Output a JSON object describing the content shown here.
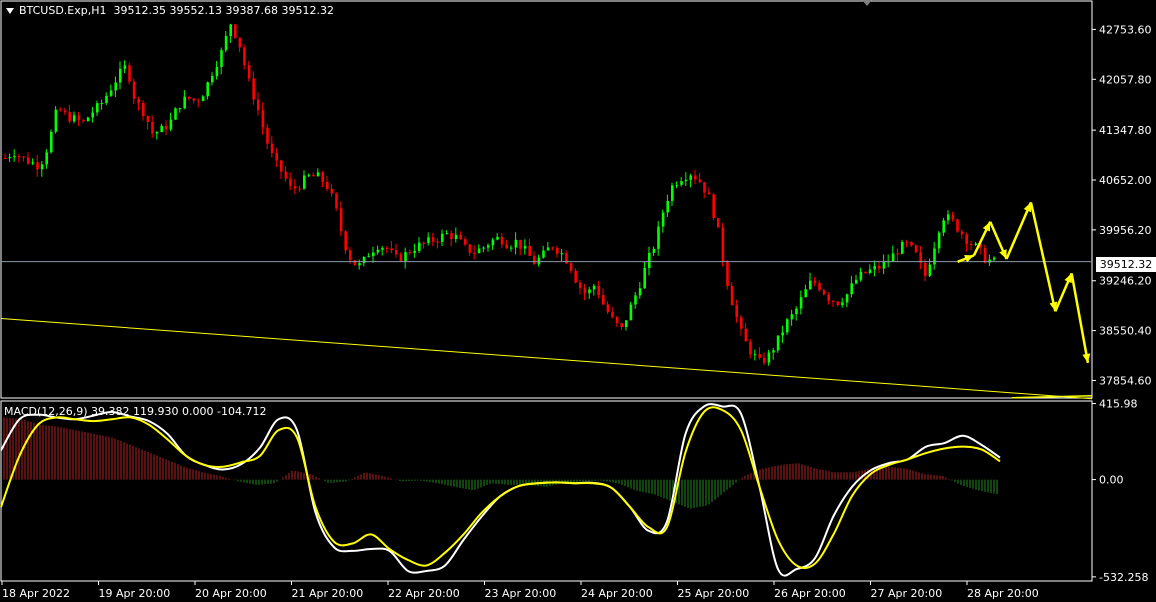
{
  "header": {
    "symbol": "BTCUSD.Exp,H1",
    "ohlc": "39512.35 39552.13 39387.68 39512.32"
  },
  "macd_header": "MACD(12,26,9) 39.382 119.930 0.000 -104.712",
  "current_price_tag": "39512.32",
  "colors": {
    "background": "#000000",
    "bull_candle": "#00ff00",
    "bear_candle": "#ff0000",
    "grid_frame": "#ffffff",
    "trendline": "#ffff00",
    "macd_line": "#ffffff",
    "signal_line": "#ffff00",
    "hist_positive": "#b22222",
    "hist_negative": "#228b22",
    "current_price_line": "#8a9aa8"
  },
  "chart_data": [
    {
      "type": "candlestick",
      "title": "BTCUSD.Exp,H1",
      "price_axis_ticks": [
        "42753.60",
        "42057.80",
        "41347.80",
        "40652.00",
        "39956.20",
        "39246.20",
        "38550.40",
        "37854.60"
      ],
      "time_axis_ticks": [
        "18 Apr 2022",
        "19 Apr 20:00",
        "20 Apr 20:00",
        "21 Apr 20:00",
        "22 Apr 20:00",
        "23 Apr 20:00",
        "24 Apr 20:00",
        "25 Apr 20:00",
        "26 Apr 20:00",
        "27 Apr 20:00",
        "28 Apr 20:00"
      ],
      "ylim": [
        37610,
        43150
      ],
      "current_price": 39512.32,
      "close_path": [
        40960,
        41050,
        40950,
        40900,
        40850,
        41150,
        41650,
        41550,
        41500,
        41450,
        41600,
        41700,
        41900,
        42100,
        42250,
        41750,
        41600,
        41300,
        41350,
        41450,
        41700,
        41800,
        41750,
        41900,
        42200,
        42450,
        42850,
        42550,
        42050,
        41700,
        41250,
        40900,
        40750,
        40500,
        40600,
        40700,
        40700,
        40600,
        40300,
        39800,
        39500,
        39450,
        39650,
        39750,
        39700,
        39550,
        39600,
        39700,
        39750,
        39800,
        39850,
        39900,
        39850,
        39700,
        39650,
        39700,
        39800,
        39850,
        39750,
        39800,
        39650,
        39500,
        39600,
        39750,
        39650,
        39500,
        39200,
        39050,
        39200,
        38900,
        38700,
        38550,
        38850,
        39150,
        39500,
        39800,
        40300,
        40600,
        40700,
        40750,
        40650,
        40450,
        40050,
        39350,
        38850,
        38450,
        38250,
        38100,
        38200,
        38400,
        38650,
        38800,
        39050,
        39250,
        39150,
        39000,
        38950,
        39050,
        39250,
        39350,
        39400,
        39450,
        39550,
        39700,
        39750,
        39600,
        39300,
        39700,
        40150,
        40100,
        39950,
        39800,
        39700,
        39550,
        39510
      ],
      "forecast_arrows": [
        {
          "from_time": 117.5,
          "from_price": 39510,
          "to_time": 119.5,
          "to_price": 39600
        },
        {
          "from_time": 119.5,
          "from_price": 39600,
          "to_time": 121.5,
          "to_price": 40070
        },
        {
          "from_time": 121.5,
          "from_price": 40070,
          "to_time": 123.5,
          "to_price": 39550
        },
        {
          "from_time": 123.5,
          "from_price": 39550,
          "to_time": 126.5,
          "to_price": 40340
        },
        {
          "from_time": 126.5,
          "from_price": 40340,
          "to_time": 129.5,
          "to_price": 38820
        },
        {
          "from_time": 129.5,
          "from_price": 38820,
          "to_time": 131.5,
          "to_price": 39350
        },
        {
          "from_time": 131.5,
          "from_price": 39350,
          "to_time": 133.5,
          "to_price": 38100
        }
      ],
      "trendline": [
        {
          "time": 0,
          "price": 38720
        },
        {
          "time": 134,
          "price": 37600
        }
      ]
    },
    {
      "type": "line",
      "title": "MACD(12,26,9)",
      "axis_ticks": [
        "415.98",
        "0.00",
        "-532.258"
      ],
      "ylim": [
        -555,
        430
      ],
      "series": [
        {
          "name": "MACD",
          "values": [
            160,
            330,
            355,
            340,
            330,
            350,
            370,
            345,
            320,
            250,
            130,
            80,
            55,
            85,
            175,
            330,
            270,
            -180,
            -370,
            -390,
            -380,
            -390,
            -500,
            -500,
            -470,
            -330,
            -200,
            -90,
            -35,
            -20,
            -15,
            -20,
            -18,
            -45,
            -150,
            -280,
            -230,
            250,
            400,
            400,
            360,
            -40,
            -490,
            -490,
            -430,
            -200,
            -40,
            50,
            90,
            110,
            180,
            200,
            240,
            190,
            120
          ]
        },
        {
          "name": "Signal",
          "values": [
            -150,
            130,
            300,
            340,
            330,
            320,
            330,
            340,
            300,
            220,
            130,
            80,
            70,
            95,
            130,
            270,
            230,
            -150,
            -340,
            -350,
            -300,
            -380,
            -440,
            -470,
            -400,
            -300,
            -180,
            -90,
            -35,
            -20,
            -15,
            -20,
            -20,
            -45,
            -150,
            -260,
            -260,
            150,
            370,
            380,
            270,
            -40,
            -330,
            -470,
            -460,
            -300,
            -90,
            30,
            80,
            110,
            145,
            170,
            180,
            165,
            100
          ]
        }
      ],
      "histogram": [
        340,
        330,
        300,
        290,
        270,
        250,
        230,
        190,
        150,
        110,
        70,
        40,
        20,
        -10,
        -30,
        -20,
        50,
        30,
        -20,
        -10,
        40,
        20,
        -10,
        -5,
        -20,
        -40,
        -60,
        -20,
        -30,
        -30,
        -40,
        -20,
        -10,
        -5,
        -20,
        -60,
        -80,
        -120,
        -160,
        -140,
        -60,
        20,
        60,
        80,
        90,
        60,
        40,
        40,
        60,
        70,
        60,
        30,
        20,
        -30,
        -60,
        -80
      ]
    }
  ]
}
